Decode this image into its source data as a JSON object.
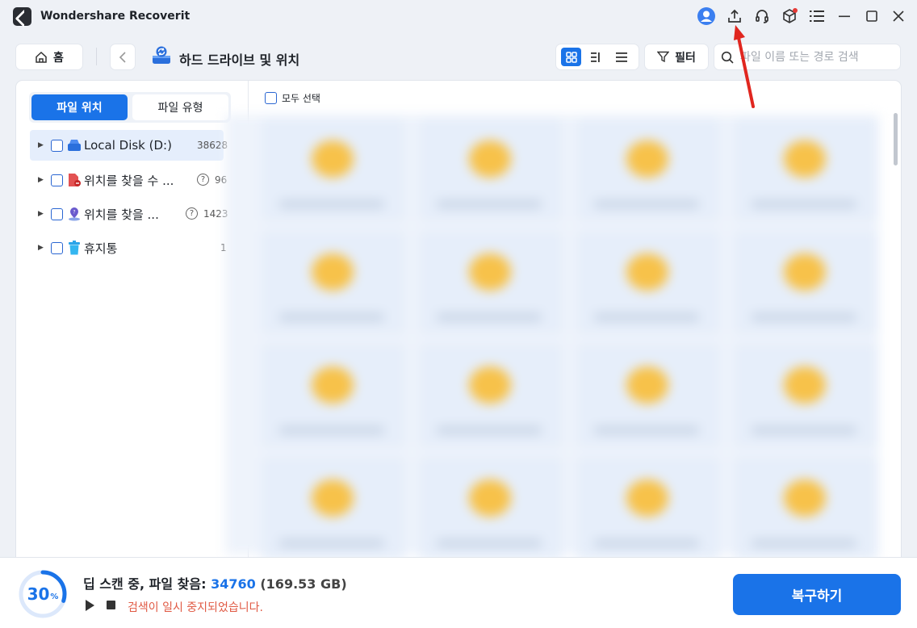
{
  "window": {
    "title": "Wondershare Recoverit"
  },
  "toolbar": {
    "home_label": "홈",
    "page_title": "하드 드라이브 및 위치",
    "filter_label": "필터",
    "search_placeholder": "파일 이름 또는 경로 검색"
  },
  "sidebar": {
    "tabs": [
      {
        "label": "파일 위치",
        "active": true
      },
      {
        "label": "파일 유형",
        "active": false
      }
    ],
    "items": [
      {
        "label": "Local Disk (D:)",
        "count": "38628",
        "icon": "disk-icon"
      },
      {
        "label": "위치를 찾을 수 ...",
        "count": "96",
        "icon": "lost-file-icon"
      },
      {
        "label": "위치를 찾을 ...",
        "count": "1423",
        "icon": "lost-location-icon"
      },
      {
        "label": "휴지통",
        "count": "1",
        "icon": "trash-icon"
      }
    ]
  },
  "content": {
    "select_all_label": "모두 선택"
  },
  "bottom": {
    "progress_value": "30",
    "progress_unit": "%",
    "status_prefix": "딥 스캔 중, 파일 찾음:",
    "files_found": "34760",
    "size": "(169.53 GB)",
    "paused_message": "검색이 일시 중지되었습니다.",
    "recover_label": "복구하기"
  },
  "colors": {
    "accent": "#1a73e8",
    "warning_text": "#e05a44",
    "annotation_arrow": "#e0261f"
  }
}
